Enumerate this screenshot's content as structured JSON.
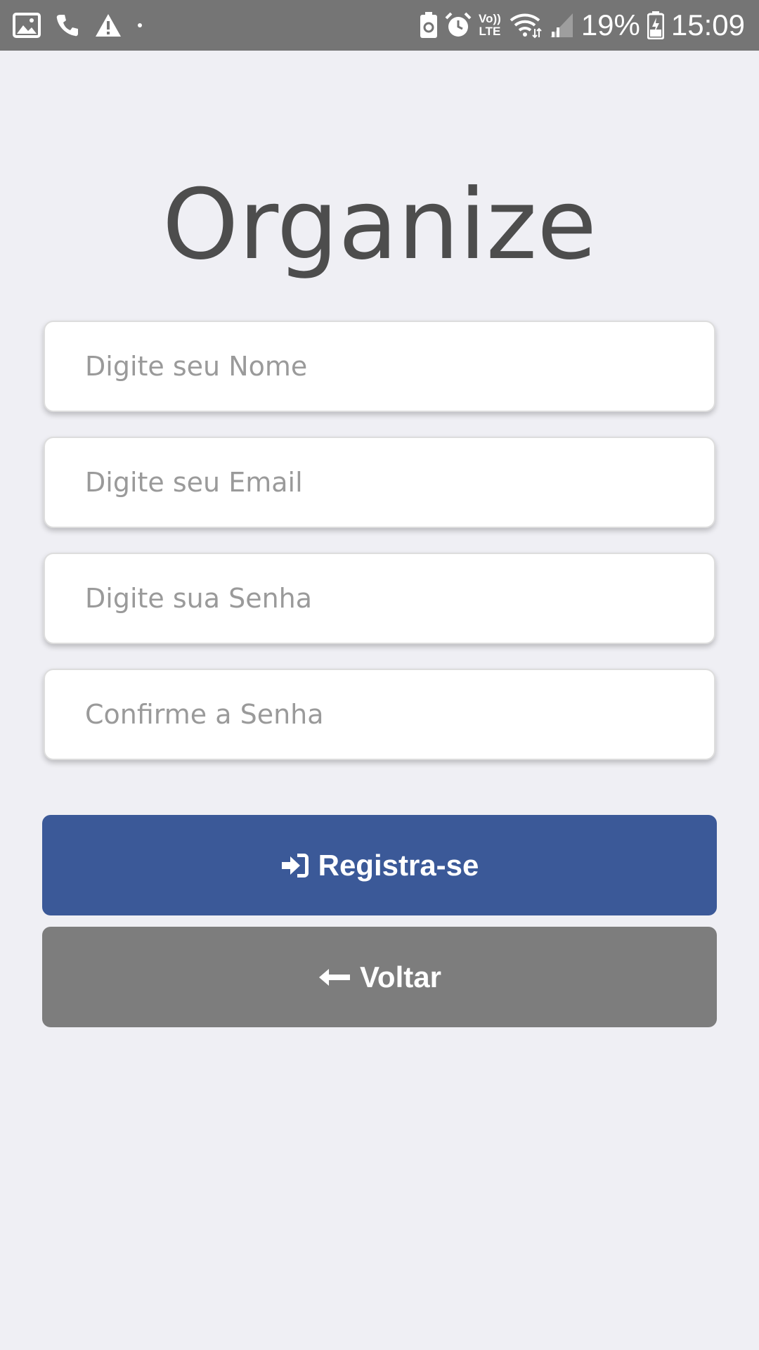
{
  "status_bar": {
    "battery_percent": "19%",
    "time": "15:09",
    "volte_top": "Vo))",
    "volte_bottom": "LTE",
    "icons": [
      "image-icon",
      "phone-icon",
      "warning-icon",
      "dot-icon",
      "battery-saver-icon",
      "alarm-icon",
      "volte-icon",
      "wifi-icon",
      "signal-icon",
      "battery-charging-icon"
    ]
  },
  "app": {
    "title": "Organize"
  },
  "form": {
    "name_placeholder": "Digite seu Nome",
    "email_placeholder": "Digite seu Email",
    "password_placeholder": "Digite sua Senha",
    "confirm_placeholder": "Confirme a Senha"
  },
  "buttons": {
    "register_label": "Registra-se",
    "register_icon": "sign-in-icon",
    "register_color": "#3b5998",
    "back_label": "Voltar",
    "back_icon": "arrow-left-icon",
    "back_color": "#7d7d7d"
  }
}
